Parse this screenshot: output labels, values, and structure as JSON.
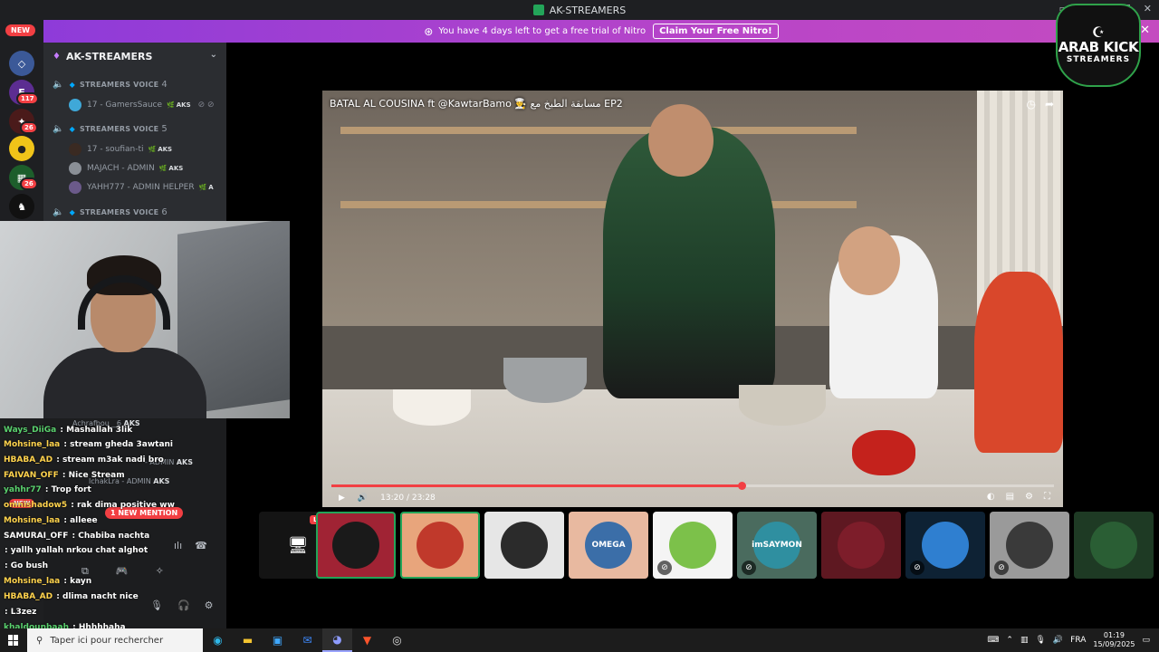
{
  "window": {
    "title": "AK-STREAMERS",
    "controls": [
      "▭",
      "?",
      "—",
      "☐",
      "✕"
    ]
  },
  "banner": {
    "text": "You have 4 days left to get a free trial of Nitro",
    "button": "Claim Your Free Nitro!"
  },
  "rail": {
    "new_label": "NEW",
    "badges": [
      "117",
      "26",
      "26"
    ]
  },
  "guild": {
    "name": "AK-STREAMERS"
  },
  "voice_channels": [
    {
      "name": "STREAMERS VOICE",
      "number": "4"
    },
    {
      "name": "STREAMERS VOICE",
      "number": "5"
    },
    {
      "name": "STREAMERS VOICE",
      "number": "6"
    }
  ],
  "members": [
    {
      "name": "17 - GamersSauce",
      "tag": "AKS"
    },
    {
      "name": "17 - soufian-ti",
      "tag": "AKS"
    },
    {
      "name": "MAJACH - ADMIN",
      "tag": "AKS"
    },
    {
      "name": "YAHH777 - ADMIN HELPER",
      "tag": "A"
    }
  ],
  "chat": [
    {
      "user": "Ways_DiiGa",
      "message": "Mashallah 3lik",
      "color": "#5ad16e"
    },
    {
      "user": "Mohsine_laa",
      "message": "stream gheda 3awtani",
      "color": "#ffd34d"
    },
    {
      "user": "HBABA_AD",
      "message": "stream m3ak nadi bro",
      "color": "#ffd34d"
    },
    {
      "user": "FAIVAN_OFF",
      "message": "Nice Stream",
      "color": "#ffd34d"
    },
    {
      "user": "yahhr77",
      "message": "Trop fort",
      "color": "#5ad16e"
    },
    {
      "user": "omnishadow5",
      "message": "rak dima positive ww",
      "color": "#ffd34d"
    },
    {
      "user": "Mohsine_laa",
      "message": "alleee",
      "color": "#ffd34d"
    },
    {
      "user": "SAMURAI_OFF",
      "message": "Chabiba nachta",
      "color": "#ffffff"
    },
    {
      "user": "",
      "message": "yallh yallah nrkou chat alghot",
      "color": "#ff5a5a"
    },
    {
      "user": "",
      "message": "Go bush",
      "color": "#9b6bff"
    },
    {
      "user": "Mohsine_laa",
      "message": "kayn",
      "color": "#ffd34d"
    },
    {
      "user": "HBABA_AD",
      "message": "dlima nacht nice",
      "color": "#ffd34d"
    },
    {
      "user": "",
      "message": "L3zez",
      "color": "#ff5a5a"
    },
    {
      "user": "khaldounbaah",
      "message": "Hhhhhaha",
      "color": "#5ad16e"
    }
  ],
  "chat_overlay_labels": {
    "bg_member_1": "Achrafbou__6",
    "bg_member_1_tag": "AKS",
    "bg_member_2": "lchakLra - ADMIN",
    "bg_member_2_tag": "AKS",
    "bg_member_3": "- ADMIN",
    "bg_member_3_tag": "AKS",
    "new_pill": "NEW",
    "mention": "1 NEW MENTION"
  },
  "video": {
    "title": "BATAL AL COUSINA ft @KawtarBamo 👨‍🍳 مسابقة الطبخ مع EP2",
    "current_time": "13:20",
    "duration": "23:28",
    "progress": 0.568
  },
  "participants": {
    "live_label": "LIVE",
    "tiles": [
      {
        "label": "",
        "bg": "#a02334",
        "pic": "#1a1a1a",
        "selected": true,
        "muted": false
      },
      {
        "label": "",
        "bg": "#e8a57c",
        "pic": "#c0392b",
        "selected": true,
        "muted": false
      },
      {
        "label": "",
        "bg": "#e6e6e6",
        "pic": "#2b2b2b",
        "selected": false,
        "muted": false
      },
      {
        "label": "OMEGA",
        "bg": "#e8b9a0",
        "pic": "#3b6ea8",
        "selected": false,
        "muted": false
      },
      {
        "label": "",
        "bg": "#f4f4f4",
        "pic": "#7cc14a",
        "selected": false,
        "muted": true
      },
      {
        "label": "imSAYMON",
        "bg": "#4a6b5e",
        "pic": "#2f8fa0",
        "selected": false,
        "muted": true
      },
      {
        "label": "",
        "bg": "#5e1821",
        "pic": "#7d1d2a",
        "selected": false,
        "muted": false
      },
      {
        "label": "",
        "bg": "#0e2234",
        "pic": "#2f7fd0",
        "selected": false,
        "muted": true
      },
      {
        "label": "",
        "bg": "#9a9a9a",
        "pic": "#3a3a3a",
        "selected": false,
        "muted": true
      },
      {
        "label": "",
        "bg": "#1e3a24",
        "pic": "#2a5e34",
        "selected": false,
        "muted": false
      }
    ]
  },
  "logo": {
    "line1": "ARAB KICK",
    "line2": "STREAMERS"
  },
  "taskbar": {
    "search_placeholder": "Taper ici pour rechercher",
    "language": "FRA",
    "time": "01:19",
    "date": "15/09/2025"
  },
  "colors": {
    "accent": "#5865f2",
    "live": "#f23f43",
    "online": "#23a559"
  }
}
